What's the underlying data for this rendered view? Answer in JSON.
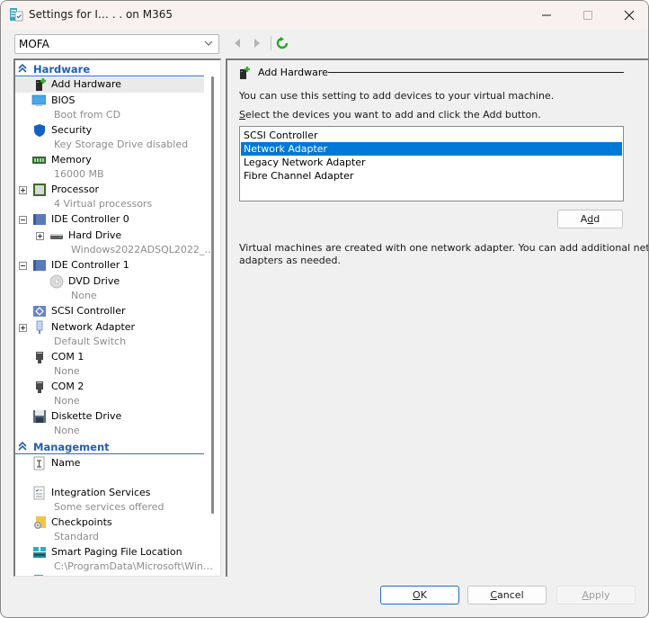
{
  "window": {
    "title": "Settings for I… . . on M365",
    "controls": {
      "minimize": "minimize",
      "maximize": "maximize",
      "close": "close"
    }
  },
  "toolbar": {
    "vm_selector": {
      "value": "MOFA"
    },
    "back_label": "Back",
    "forward_label": "Forward",
    "refresh_label": "Refresh"
  },
  "tree": {
    "sections": [
      {
        "label": "Hardware"
      },
      {
        "label": "Management"
      }
    ],
    "hardware": [
      {
        "label": "Add Hardware",
        "sub": "",
        "icon": "add-hardware-icon",
        "selected": true
      },
      {
        "label": "BIOS",
        "sub": "Boot from CD",
        "icon": "monitor-icon"
      },
      {
        "label": "Security",
        "sub": "Key Storage Drive disabled",
        "icon": "shield-icon"
      },
      {
        "label": "Memory",
        "sub": "16000 MB",
        "icon": "memory-icon"
      },
      {
        "label": "Processor",
        "sub": "4 Virtual processors",
        "icon": "processor-icon",
        "expander": "+"
      },
      {
        "label": "IDE Controller 0",
        "sub": "",
        "icon": "ide-controller-icon",
        "expander": "-"
      },
      {
        "label": "Hard Drive",
        "sub": "Windows2022ADSQL2022_…",
        "icon": "hard-drive-icon",
        "expander": "+"
      },
      {
        "label": "IDE Controller 1",
        "sub": "",
        "icon": "ide-controller-icon",
        "expander": "-"
      },
      {
        "label": "DVD Drive",
        "sub": "None",
        "icon": "dvd-icon"
      },
      {
        "label": "SCSI Controller",
        "sub": "",
        "icon": "scsi-controller-icon"
      },
      {
        "label": "Network Adapter",
        "sub": "Default Switch",
        "icon": "network-adapter-icon",
        "expander": "+"
      },
      {
        "label": "COM 1",
        "sub": "None",
        "icon": "com-port-icon"
      },
      {
        "label": "COM 2",
        "sub": "None",
        "icon": "com-port-icon"
      },
      {
        "label": "Diskette Drive",
        "sub": "None",
        "icon": "floppy-icon"
      }
    ],
    "management": [
      {
        "label": "Name",
        "sub": "",
        "icon": "name-icon"
      },
      {
        "label": "Integration Services",
        "sub": "Some services offered",
        "icon": "integration-services-icon"
      },
      {
        "label": "Checkpoints",
        "sub": "Standard",
        "icon": "checkpoints-icon"
      },
      {
        "label": "Smart Paging File Location",
        "sub": "C:\\ProgramData\\Microsoft\\Win…",
        "icon": "smart-paging-icon"
      }
    ]
  },
  "detail": {
    "heading": "Add Hardware",
    "intro": "You can use this setting to add devices to your virtual machine.",
    "instruction_prefix": "S",
    "instruction_rest": "elect the devices you want to add and click the Add button.",
    "devices": [
      {
        "label": "SCSI Controller",
        "selected": false
      },
      {
        "label": "Network Adapter",
        "selected": true
      },
      {
        "label": "Legacy Network Adapter",
        "selected": false
      },
      {
        "label": "Fibre Channel Adapter",
        "selected": false
      }
    ],
    "add_button": {
      "pre": "A",
      "mnemonic": "d",
      "post": "d"
    },
    "note_line1": "Virtual machines are created with one network adapter. You can add additional network",
    "note_line2": "adapters as needed."
  },
  "footer": {
    "ok": {
      "mnemonic": "O",
      "rest": "K"
    },
    "cancel": {
      "mnemonic": "C",
      "rest": "ancel"
    },
    "apply": {
      "mnemonic": "A",
      "rest": "pply",
      "disabled": true
    }
  },
  "colors": {
    "accent": "#0078d7",
    "section_header": "#1f5fb3",
    "subtext": "#8c8c8c",
    "refresh_green": "#2aa52a"
  }
}
